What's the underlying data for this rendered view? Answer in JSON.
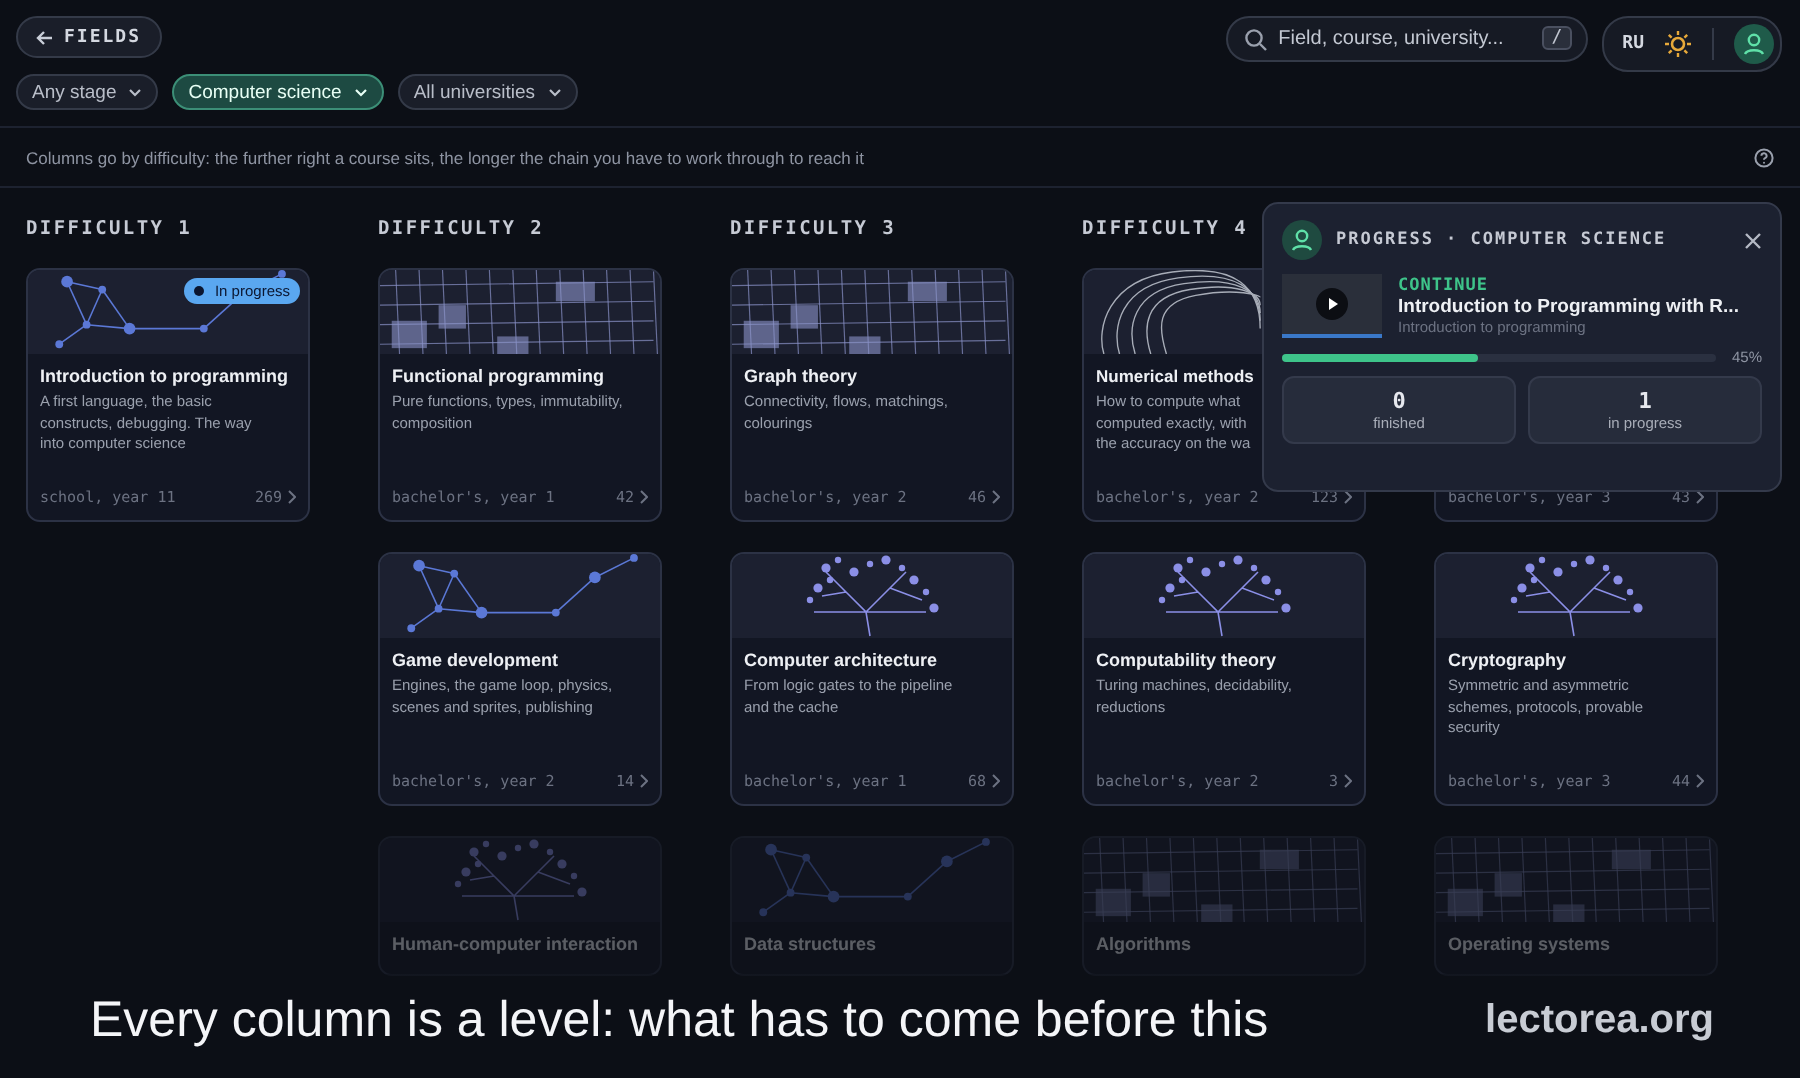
{
  "top_bar": {
    "back_button": {
      "label": "FIELDS"
    },
    "search": {
      "placeholder": "Field, course, university...",
      "shortcut": "/"
    },
    "language": "RU"
  },
  "filters": [
    {
      "label": "Any stage",
      "selected": false
    },
    {
      "label": "Computer science",
      "selected": true
    },
    {
      "label": "All universities",
      "selected": false
    }
  ],
  "hint": "Columns go by difficulty: the further right a course sits, the longer the chain you have to work through to reach it",
  "columns": [
    {
      "heading": "DIFFICULTY 1",
      "cards": [
        {
          "title": "Introduction to programming",
          "description_lines": [
            "A first language, the basic",
            "constructs, debugging. The way",
            "into computer science"
          ],
          "stage": "school, year 11",
          "count": "269",
          "badge": "In progress",
          "art": {
            "kind": "network"
          },
          "faded": false,
          "partial": false
        }
      ]
    },
    {
      "heading": "DIFFICULTY 2",
      "cards": [
        {
          "title": "Functional programming",
          "description_lines": [
            "Pure functions, types, immutability,",
            "composition"
          ],
          "stage": "bachelor's, year 1",
          "count": "42",
          "art": {
            "kind": "grid"
          },
          "faded": false,
          "partial": false
        },
        {
          "title": "Game development",
          "description_lines": [
            "Engines, the game loop, physics,",
            "scenes and sprites, publishing"
          ],
          "stage": "bachelor's, year 2",
          "count": "14",
          "art": {
            "kind": "network"
          },
          "faded": false,
          "partial": false
        },
        {
          "title": "Human-computer interaction",
          "art": {
            "kind": "tree"
          },
          "faded": true,
          "partial": false
        }
      ]
    },
    {
      "heading": "DIFFICULTY 3",
      "cards": [
        {
          "title": "Graph theory",
          "description_lines": [
            "Connectivity, flows, matchings,",
            "colourings"
          ],
          "stage": "bachelor's, year 2",
          "count": "46",
          "art": {
            "kind": "grid"
          },
          "faded": false,
          "partial": false
        },
        {
          "title": "Computer architecture",
          "description_lines": [
            "From logic gates to the pipeline",
            "and the cache"
          ],
          "stage": "bachelor's, year 1",
          "count": "68",
          "art": {
            "kind": "tree"
          },
          "faded": false,
          "partial": false
        },
        {
          "title": "Data structures",
          "art": {
            "kind": "network"
          },
          "faded": true,
          "partial": false
        }
      ]
    },
    {
      "heading": "DIFFICULTY 4",
      "cards": [
        {
          "title": "Numerical methods",
          "description_lines": [
            "How to compute what",
            "computed exactly, with",
            "the accuracy on the wa"
          ],
          "stage": "bachelor's, year 2",
          "count": "123",
          "art": {
            "kind": "contour"
          },
          "faded": false,
          "partial": true
        },
        {
          "title": "Computability theory",
          "description_lines": [
            "Turing machines, decidability,",
            "reductions"
          ],
          "stage": "bachelor's, year 2",
          "count": "3",
          "art": {
            "kind": "tree"
          },
          "faded": false,
          "partial": false
        },
        {
          "title": "Algorithms",
          "art": {
            "kind": "grid"
          },
          "faded": true,
          "partial": false
        }
      ]
    },
    {
      "cards": [
        {
          "stage": "bachelor's, year 3",
          "count": "43",
          "faded": false
        },
        {
          "title": "Cryptography",
          "description_lines": [
            "Symmetric and asymmetric",
            "schemes, protocols, provable",
            "security"
          ],
          "stage": "bachelor's, year 3",
          "count": "44",
          "art": {
            "kind": "tree"
          },
          "faded": false,
          "partial": false
        },
        {
          "title": "Operating systems",
          "art": {
            "kind": "grid"
          },
          "faded": true,
          "partial": false
        }
      ]
    }
  ],
  "progress_panel": {
    "title": "PROGRESS · COMPUTER SCIENCE",
    "continue_label": "CONTINUE",
    "video_title": "Introduction to Programming with R...",
    "course": "Introduction to programming",
    "level": 0.45,
    "percent": "45%",
    "stats": [
      {
        "value": "0",
        "label": "finished"
      },
      {
        "value": "1",
        "label": "in progress"
      }
    ]
  },
  "caption": {
    "text": "Every column is a level: what has to come before this",
    "site": "lectorea.org"
  }
}
